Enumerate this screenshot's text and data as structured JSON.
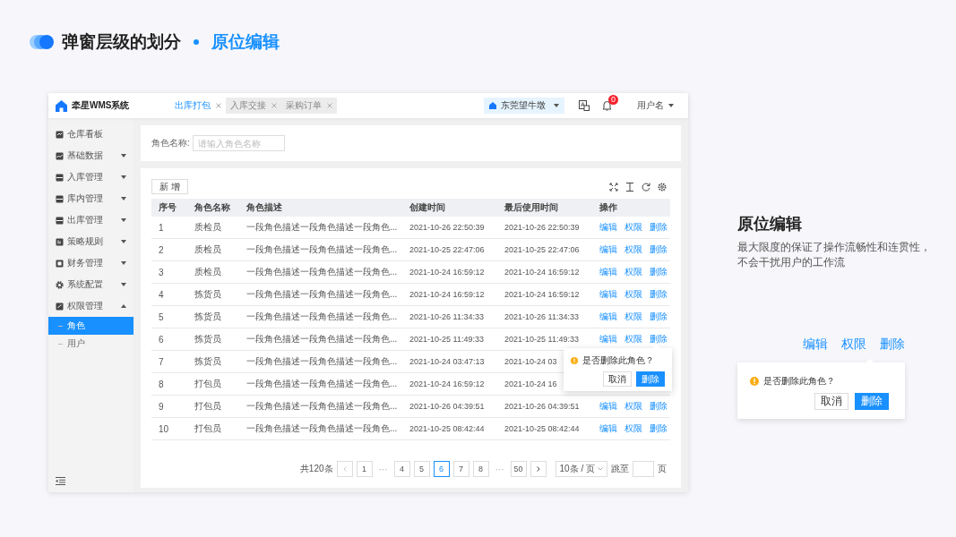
{
  "heading": {
    "title": "弹窗层级的划分",
    "subtitle": "原位编辑"
  },
  "app": {
    "logo_text": "牵星WMS系统",
    "tabs": [
      {
        "label": "出库打包",
        "selected": true
      },
      {
        "label": "入库交接",
        "selected": false
      },
      {
        "label": "采购订单",
        "selected": false
      }
    ],
    "warehouse": "东莞望牛墩",
    "notification_count": "0",
    "user": "用户名",
    "sidebar": {
      "items": [
        {
          "label": "仓库看板"
        },
        {
          "label": "基础数据",
          "expanded": false
        },
        {
          "label": "入库管理",
          "expanded": false
        },
        {
          "label": "库内管理",
          "expanded": false
        },
        {
          "label": "出库管理",
          "expanded": false
        },
        {
          "label": "策略规则",
          "expanded": false
        },
        {
          "label": "财务管理",
          "expanded": false
        },
        {
          "label": "系统配置",
          "expanded": false
        },
        {
          "label": "权限管理",
          "expanded": true,
          "children": [
            {
              "label": "角色",
              "selected": true
            },
            {
              "label": "用户",
              "selected": false
            }
          ]
        }
      ]
    },
    "search": {
      "label": "角色名称:",
      "placeholder": "请输入角色名称"
    },
    "add_button": "新 增",
    "table": {
      "columns": [
        "序号",
        "角色名称",
        "角色描述",
        "创建时间",
        "最后使用时间",
        "操作"
      ],
      "rows": [
        {
          "cells": [
            "1",
            "质检员",
            "一段角色描述一段角色描述一段角色...",
            "2021-10-26 22:50:39",
            "2021-10-26 22:50:39"
          ],
          "actions": [
            "编辑",
            "权限",
            "删除"
          ]
        },
        {
          "cells": [
            "2",
            "质检员",
            "一段角色描述一段角色描述一段角色...",
            "2021-10-25 22:47:06",
            "2021-10-25 22:47:06"
          ],
          "actions": [
            "编辑",
            "权限",
            "删除"
          ]
        },
        {
          "cells": [
            "3",
            "质检员",
            "一段角色描述一段角色描述一段角色...",
            "2021-10-24 16:59:12",
            "2021-10-24 16:59:12"
          ],
          "actions": [
            "编辑",
            "权限",
            "删除"
          ]
        },
        {
          "cells": [
            "4",
            "拣货员",
            "一段角色描述一段角色描述一段角色...",
            "2021-10-24 16:59:12",
            "2021-10-24 16:59:12"
          ],
          "actions": [
            "编辑",
            "权限",
            "删除"
          ]
        },
        {
          "cells": [
            "5",
            "拣货员",
            "一段角色描述一段角色描述一段角色...",
            "2021-10-26 11:34:33",
            "2021-10-26 11:34:33"
          ],
          "actions": [
            "编辑",
            "权限",
            "删除"
          ]
        },
        {
          "cells": [
            "6",
            "拣货员",
            "一段角色描述一段角色描述一段角色...",
            "2021-10-25 11:49:33",
            "2021-10-25 11:49:33"
          ],
          "actions": [
            "编辑",
            "权限",
            "删除"
          ]
        },
        {
          "cells": [
            "7",
            "拣货员",
            "一段角色描述一段角色描述一段角色...",
            "2021-10-24 03:47:13",
            "2021-10-24 03"
          ]
        },
        {
          "cells": [
            "8",
            "打包员",
            "一段角色描述一段角色描述一段角色...",
            "2021-10-24 16:59:12",
            "2021-10-24 16"
          ]
        },
        {
          "cells": [
            "9",
            "打包员",
            "一段角色描述一段角色描述一段角色...",
            "2021-10-26 04:39:51",
            "2021-10-26 04:39:51"
          ],
          "actions": [
            "编辑",
            "权限",
            "删除"
          ]
        },
        {
          "cells": [
            "10",
            "打包员",
            "一段角色描述一段角色描述一段角色...",
            "2021-10-25 08:42:44",
            "2021-10-25 08:42:44"
          ],
          "actions": [
            "编辑",
            "权限",
            "删除"
          ]
        }
      ]
    },
    "popover": {
      "message": "是否删除此角色？",
      "buttons": [
        {
          "label": "取消",
          "primary": false
        },
        {
          "label": "删除",
          "primary": true
        }
      ]
    },
    "pagination": {
      "total": "共120条",
      "prev": {
        "disabled": true
      },
      "next": {
        "disabled": false
      },
      "pages": [
        {
          "kind": "page",
          "label": "1",
          "selected": false
        },
        {
          "kind": "ellipsis",
          "label": "···"
        },
        {
          "kind": "page",
          "label": "4",
          "selected": false
        },
        {
          "kind": "page",
          "label": "5",
          "selected": false
        },
        {
          "kind": "page",
          "label": "6",
          "selected": true
        },
        {
          "kind": "page",
          "label": "7",
          "selected": false
        },
        {
          "kind": "page",
          "label": "8",
          "selected": false
        },
        {
          "kind": "ellipsis",
          "label": "···"
        },
        {
          "kind": "page",
          "label": "50",
          "selected": false
        }
      ],
      "page_size": "10条 / 页",
      "jump_label": "跳至",
      "page_unit": "页"
    }
  },
  "aside": {
    "title": "原位编辑",
    "description_lines": [
      "最大限度的保证了操作流畅性和连贯性，",
      "不会干扰用户的工作流"
    ],
    "actions": [
      "编辑",
      "权限",
      "删除"
    ],
    "popover": {
      "message": "是否删除此角色？",
      "buttons": [
        {
          "label": "取消",
          "primary": false
        },
        {
          "label": "删除",
          "primary": true
        }
      ]
    }
  }
}
